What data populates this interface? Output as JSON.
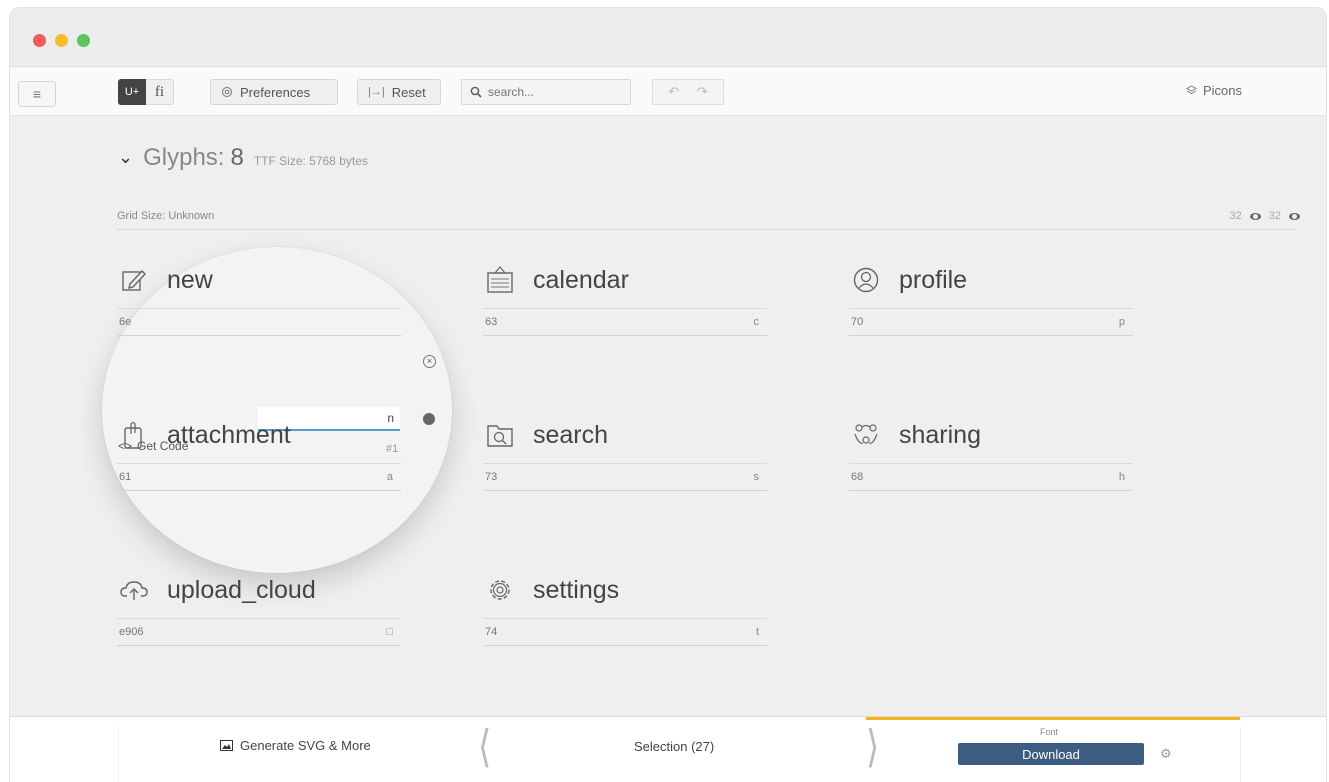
{
  "toolbar": {
    "unicode_toggle": "U+",
    "ligature_toggle": "fi",
    "preferences_label": "Preferences",
    "reset_label": "Reset",
    "search_placeholder": "search...",
    "app_name": "Picons"
  },
  "main": {
    "section_title": "Glyphs:",
    "glyph_count": "8",
    "ttf_size": "TTF Size: 5768 bytes",
    "grid_size": "Grid Size: Unknown",
    "preview_size_1": "32",
    "preview_size_2": "32"
  },
  "glyphs": [
    {
      "name": "new",
      "code": "6e",
      "char": "n",
      "icon": "edit-icon"
    },
    {
      "name": "calendar",
      "code": "63",
      "char": "c",
      "icon": "calendar-icon"
    },
    {
      "name": "profile",
      "code": "70",
      "char": "p",
      "icon": "profile-icon"
    },
    {
      "name": "attachment",
      "code": "61",
      "char": "a",
      "icon": "attachment-icon"
    },
    {
      "name": "search",
      "code": "73",
      "char": "s",
      "icon": "folder-search-icon"
    },
    {
      "name": "sharing",
      "code": "68",
      "char": "h",
      "icon": "sharing-icon"
    },
    {
      "name": "upload_cloud",
      "code": "e906",
      "char": "□",
      "icon": "upload-cloud-icon"
    },
    {
      "name": "settings",
      "code": "74",
      "char": "t",
      "icon": "gear-icon"
    }
  ],
  "editor": {
    "char_value": "n",
    "get_code_label": "Get Code",
    "index_tag": "#1"
  },
  "footer": {
    "generate_label": "Generate SVG & More",
    "selection_label": "Selection (27)",
    "font_label": "Font",
    "download_label": "Download"
  },
  "colors": {
    "accent_blue": "#3d5c82",
    "input_underline": "#4b9fd5",
    "font_tab_accent": "#f3b41b"
  }
}
